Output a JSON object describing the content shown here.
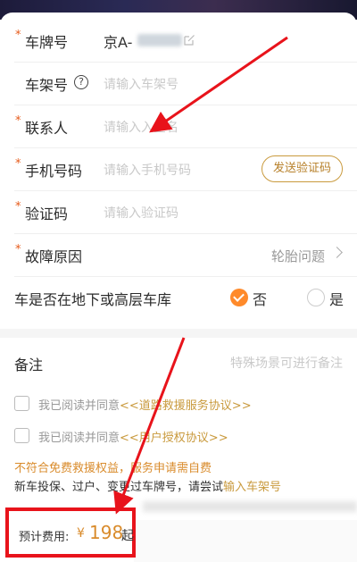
{
  "form": {
    "plate": {
      "label": "车牌号",
      "value": "京A-"
    },
    "frame": {
      "label": "车架号",
      "placeholder": "请输入车架号",
      "help_glyph": "?"
    },
    "contact": {
      "label": "联系人",
      "placeholder": "请输入入全名"
    },
    "phone": {
      "label": "手机号码",
      "placeholder": "请输入手机号码",
      "code_button": "发送验证码"
    },
    "code": {
      "label": "验证码",
      "placeholder": "请输入验证码"
    },
    "fault": {
      "label": "故障原因",
      "value": "轮胎问题"
    },
    "garage": {
      "label": "车是否在地下或高层车库",
      "option_no": "否",
      "option_yes": "是",
      "selected": "否"
    },
    "required_mark": "*"
  },
  "remark": {
    "label": "备注",
    "placeholder": "特殊场景可进行备注"
  },
  "agreements": [
    {
      "prefix": "我已阅读并同意",
      "link": "<<道路救援服务协议>>",
      "checked": false
    },
    {
      "prefix": "我已阅读并同意",
      "link": "<<用户授权协议>>",
      "checked": false
    }
  ],
  "notice": {
    "line1": "不符合免费救援权益，服务申请需自费",
    "line2_prefix": "新车投保、过户、变更过车牌号，请尝试",
    "line2_link": "输入车架号"
  },
  "cost": {
    "label": "预计费用:",
    "currency": "¥",
    "value": "198",
    "unit": "起"
  },
  "colors": {
    "accent": "#ff8a2a",
    "gold": "#c99a3d",
    "highlight_red": "#e8131b"
  },
  "icons": {
    "edit": "edit-icon",
    "help": "help-icon",
    "chevron": "chevron-right-icon"
  }
}
